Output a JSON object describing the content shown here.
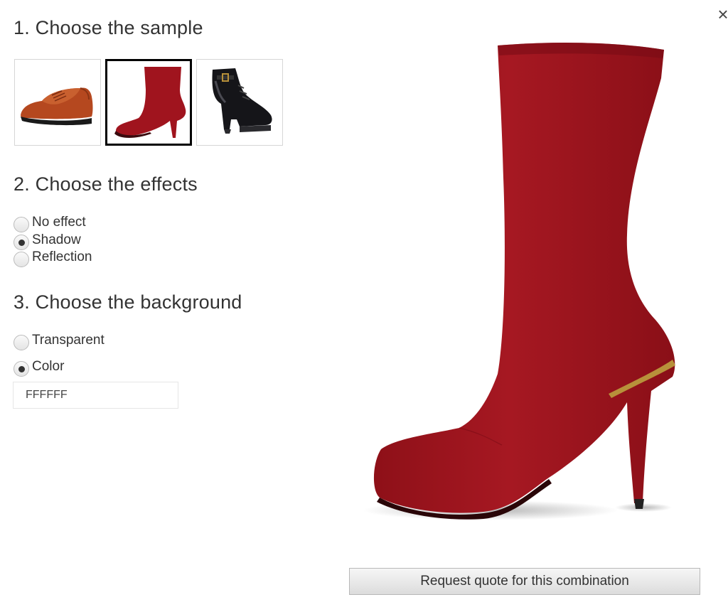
{
  "steps": {
    "sample_heading": "1. Choose the sample",
    "effects_heading": "2. Choose the effects",
    "background_heading": "3. Choose the background"
  },
  "samples": [
    {
      "name": "oxford-shoe-icon",
      "color": "#b5481f",
      "selected": false
    },
    {
      "name": "red-boot-icon",
      "color": "#a0141e",
      "selected": true
    },
    {
      "name": "black-ankle-boot-icon",
      "color": "#151519",
      "selected": false
    }
  ],
  "effects": {
    "options": [
      "No effect",
      "Shadow",
      "Reflection"
    ],
    "selected": "Shadow"
  },
  "background": {
    "options": [
      "Transparent",
      "Color"
    ],
    "selected": "Color",
    "color_value": "FFFFFF"
  },
  "buttons": {
    "quote": "Request quote for this combination",
    "close": "×"
  },
  "colors": {
    "boot_red": "#a0141e",
    "boot_red_dark": "#7a0c16",
    "heel_trim": "#b8913a",
    "text": "#333333"
  }
}
